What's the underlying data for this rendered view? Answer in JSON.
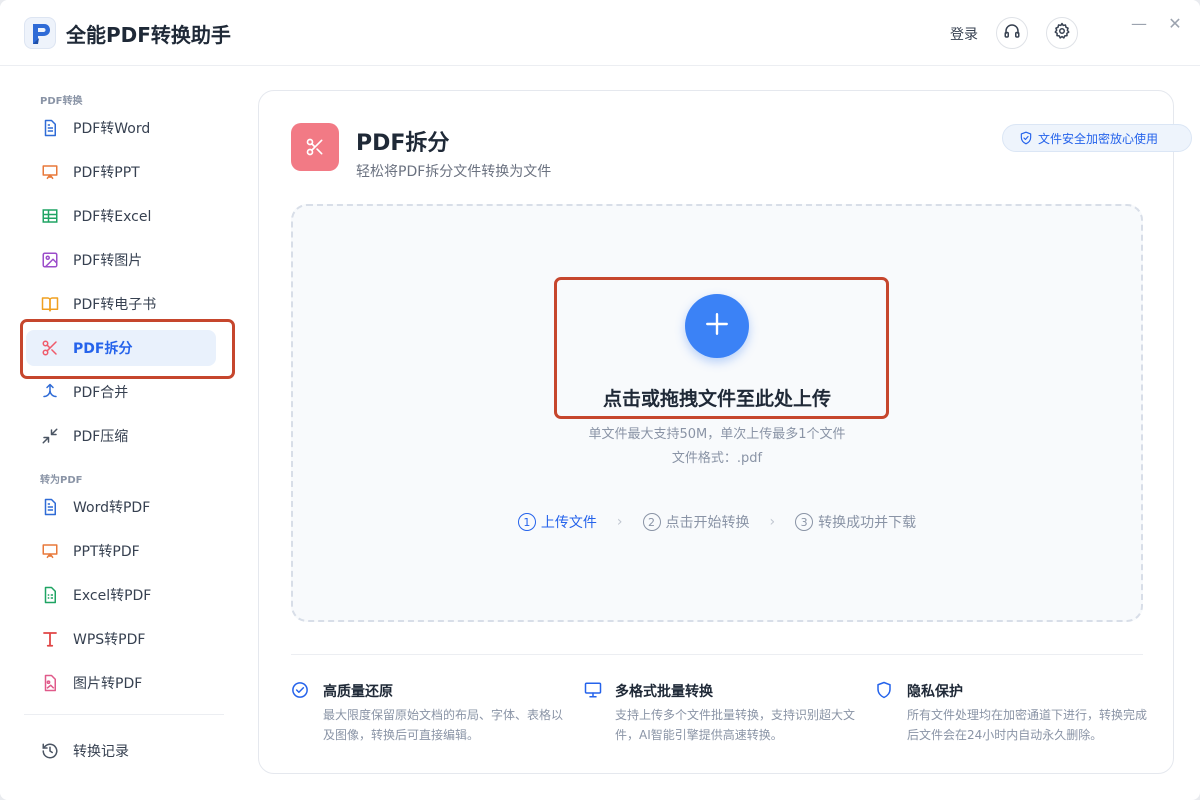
{
  "app": {
    "title": "全能PDF转换助手"
  },
  "header": {
    "login_label": "登录",
    "minimize": "—",
    "close": "✕"
  },
  "sidebar": {
    "group1_label": "PDF转换",
    "group2_label": "转为PDF",
    "items": [
      {
        "label": "PDF转Word",
        "icon": "document-icon",
        "color": "#2f6bd6"
      },
      {
        "label": "PDF转PPT",
        "icon": "presentation-icon",
        "color": "#e8793a"
      },
      {
        "label": "PDF转Excel",
        "icon": "table-icon",
        "color": "#1fa463"
      },
      {
        "label": "PDF转图片",
        "icon": "image-icon",
        "color": "#9b4dca"
      },
      {
        "label": "PDF转电子书",
        "icon": "book-icon",
        "color": "#f0a020"
      },
      {
        "label": "PDF拆分",
        "icon": "scissors-icon",
        "color": "#ef5b6b",
        "active": true
      },
      {
        "label": "PDF合并",
        "icon": "merge-icon",
        "color": "#2f6bd6"
      },
      {
        "label": "PDF压缩",
        "icon": "compress-icon",
        "color": "#4b5563"
      },
      {
        "label": "Word转PDF",
        "icon": "document-icon",
        "color": "#2f6bd6"
      },
      {
        "label": "PPT转PDF",
        "icon": "presentation-icon",
        "color": "#e8793a"
      },
      {
        "label": "Excel转PDF",
        "icon": "spreadsheet-icon",
        "color": "#1fa463"
      },
      {
        "label": "WPS转PDF",
        "icon": "text-t-icon",
        "color": "#e04545"
      },
      {
        "label": "图片转PDF",
        "icon": "image-file-icon",
        "color": "#e05a8a"
      }
    ],
    "history_label": "转换记录"
  },
  "main": {
    "title": "PDF拆分",
    "subtitle": "轻松将PDF拆分文件转换为文件",
    "security_badge": "文件安全加密放心使用",
    "dropzone": {
      "title": "点击或拖拽文件至此处上传",
      "limit_note": "单文件最大支持50M，单次上传最多1个文件",
      "format_note": "文件格式：.pdf"
    },
    "steps": [
      {
        "num": "1",
        "label": "上传文件",
        "active": true
      },
      {
        "num": "2",
        "label": "点击开始转换"
      },
      {
        "num": "3",
        "label": "转换成功并下载"
      }
    ],
    "step_separator": "›",
    "features": [
      {
        "title": "高质量还原",
        "desc": "最大限度保留原始文档的布局、字体、表格以及图像，转换后可直接编辑。",
        "icon": "check-circle-icon"
      },
      {
        "title": "多格式批量转换",
        "desc": "支持上传多个文件批量转换，支持识别超大文件，AI智能引擎提供高速转换。",
        "icon": "monitor-icon"
      },
      {
        "title": "隐私保护",
        "desc": "所有文件处理均在加密通道下进行，转换完成后文件会在24小时内自动永久删除。",
        "icon": "shield-icon"
      }
    ]
  },
  "colors": {
    "accent": "#2563eb",
    "upload": "#3b82f6",
    "highlight": "#c6462d",
    "page_icon": "#f27a85"
  }
}
